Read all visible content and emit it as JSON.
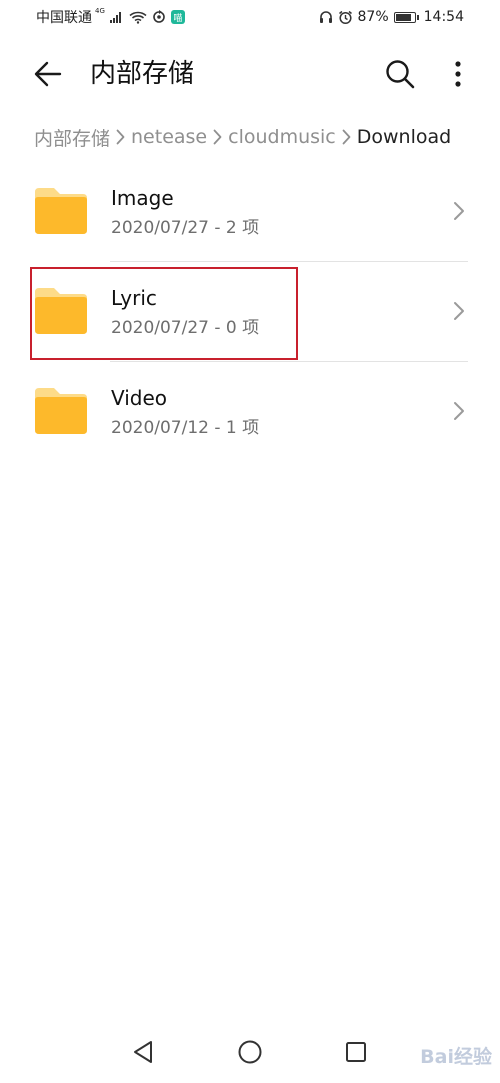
{
  "status_bar": {
    "carrier": "中国联通",
    "network": "4G",
    "app_badge": "喵",
    "battery_percent": "87%",
    "battery_level": 0.87,
    "time": "14:54"
  },
  "app_bar": {
    "title": "内部存储",
    "back_icon": "arrow-left-icon",
    "search_icon": "search-icon",
    "more_icon": "more-vertical-icon"
  },
  "breadcrumb": {
    "items": [
      "内部存储",
      "netease",
      "cloudmusic",
      "Download"
    ]
  },
  "files": [
    {
      "name": "Image",
      "meta": "2020/07/27 - 2 项"
    },
    {
      "name": "Lyric",
      "meta": "2020/07/27 - 0 项"
    },
    {
      "name": "Video",
      "meta": "2020/07/12 - 1 项"
    }
  ],
  "colors": {
    "folder": "#FDB92B",
    "folder_tab": "#FDDB88",
    "highlight": "#C8202D"
  },
  "watermark": {
    "text": "Bai经验"
  }
}
